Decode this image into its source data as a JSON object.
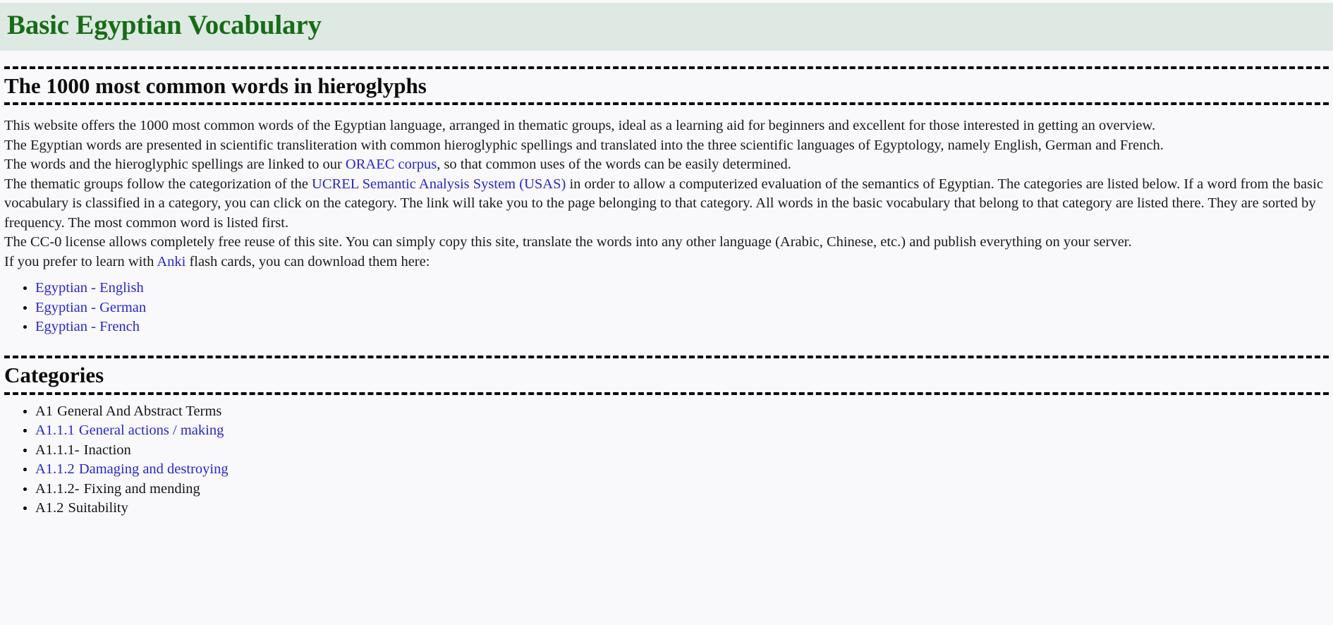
{
  "banner": {
    "title": "Basic Egyptian Vocabulary"
  },
  "sections": {
    "main_heading": "The 1000 most common words in hieroglyphs",
    "categories_heading": "Categories"
  },
  "intro": {
    "line1": "This website offers the 1000 most common words of the Egyptian language, arranged in thematic groups, ideal as a learning aid for beginners and excellent for those interested in getting an overview.",
    "line2": "The Egyptian words are presented in scientific transliteration with common hieroglyphic spellings and translated into the three scientific languages of Egyptology, namely English, German and French.",
    "line3_before": "The words and the hieroglyphic spellings are linked to our ",
    "line3_link": "ORAEC corpus",
    "line3_after": ", so that common uses of the words can be easily determined.",
    "line4_before": "The thematic groups follow the categorization of the ",
    "line4_link": "UCREL Semantic Analysis System (USAS)",
    "line4_after": " in order to allow a computerized evaluation of the semantics of Egyptian. The categories are listed below. If a word from the basic vocabulary is classified in a category, you can click on the category. The link will take you to the page belonging to that category. All words in the basic vocabulary that belong to that category are listed there. They are sorted by frequency. The most common word is listed first.",
    "line5": "The CC-0 license allows completely free reuse of this site. You can simply copy this site, translate the words into any other language (Arabic, Chinese, etc.) and publish everything on your server.",
    "line6_before": "If you prefer to learn with ",
    "line6_link": "Anki",
    "line6_after": " flash cards, you can download them here:"
  },
  "downloads": [
    {
      "label": "Egyptian - English",
      "is_link": true
    },
    {
      "label": "Egyptian - German",
      "is_link": true
    },
    {
      "label": "Egyptian - French",
      "is_link": true
    }
  ],
  "categories": [
    {
      "code": "A1",
      "name": "General And Abstract Terms",
      "is_link": false
    },
    {
      "code": "A1.1.1",
      "name": "General actions / making",
      "is_link": true
    },
    {
      "code": "A1.1.1-",
      "name": "Inaction",
      "is_link": false
    },
    {
      "code": "A1.1.2",
      "name": "Damaging and destroying",
      "is_link": true
    },
    {
      "code": "A1.1.2-",
      "name": "Fixing and mending",
      "is_link": false
    },
    {
      "code": "A1.2",
      "name": "Suitability",
      "is_link": false
    }
  ],
  "colors": {
    "banner_bg": "#dee9e3",
    "title_green": "#176c17",
    "link_blue": "#2727c8",
    "page_bg": "#f9f8fa",
    "rule": "#0a0a0a"
  }
}
